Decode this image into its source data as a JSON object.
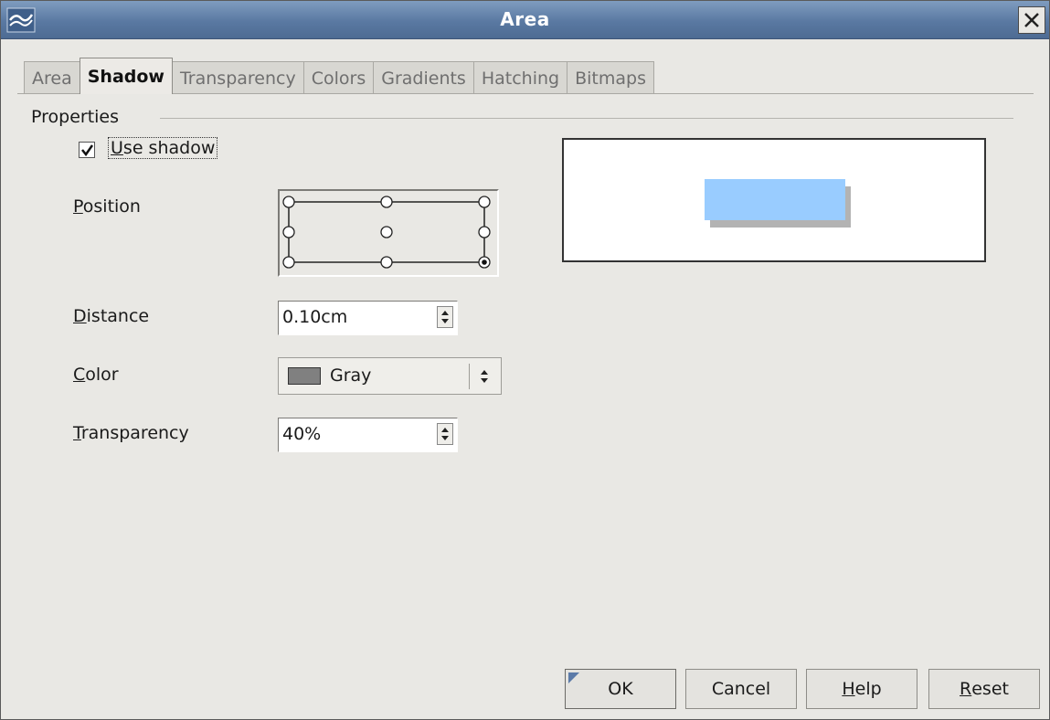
{
  "window": {
    "title": "Area"
  },
  "tabs": [
    {
      "label": "Area",
      "active": false
    },
    {
      "label": "Shadow",
      "active": true
    },
    {
      "label": "Transparency",
      "active": false
    },
    {
      "label": "Colors",
      "active": false
    },
    {
      "label": "Gradients",
      "active": false
    },
    {
      "label": "Hatching",
      "active": false
    },
    {
      "label": "Bitmaps",
      "active": false
    }
  ],
  "properties": {
    "group_label": "Properties",
    "use_shadow": {
      "label_first": "U",
      "label_rest": "se shadow",
      "checked": true
    },
    "position": {
      "label_first": "P",
      "label_rest": "osition",
      "selected": "bottom-right"
    },
    "distance": {
      "label_first": "D",
      "label_rest": "istance",
      "value": "0.10cm"
    },
    "color": {
      "label_first": "C",
      "label_rest": "olor",
      "value": "Gray",
      "swatch": "#808080"
    },
    "transparency": {
      "label_first": "T",
      "label_rest": "ransparency",
      "value": "40%"
    }
  },
  "preview": {
    "fill_color": "#99ccff",
    "shadow_color": "#b3b3b3"
  },
  "buttons": {
    "ok": "OK",
    "cancel": "Cancel",
    "help_first": "H",
    "help_rest": "elp",
    "reset_first": "R",
    "reset_rest": "eset"
  }
}
